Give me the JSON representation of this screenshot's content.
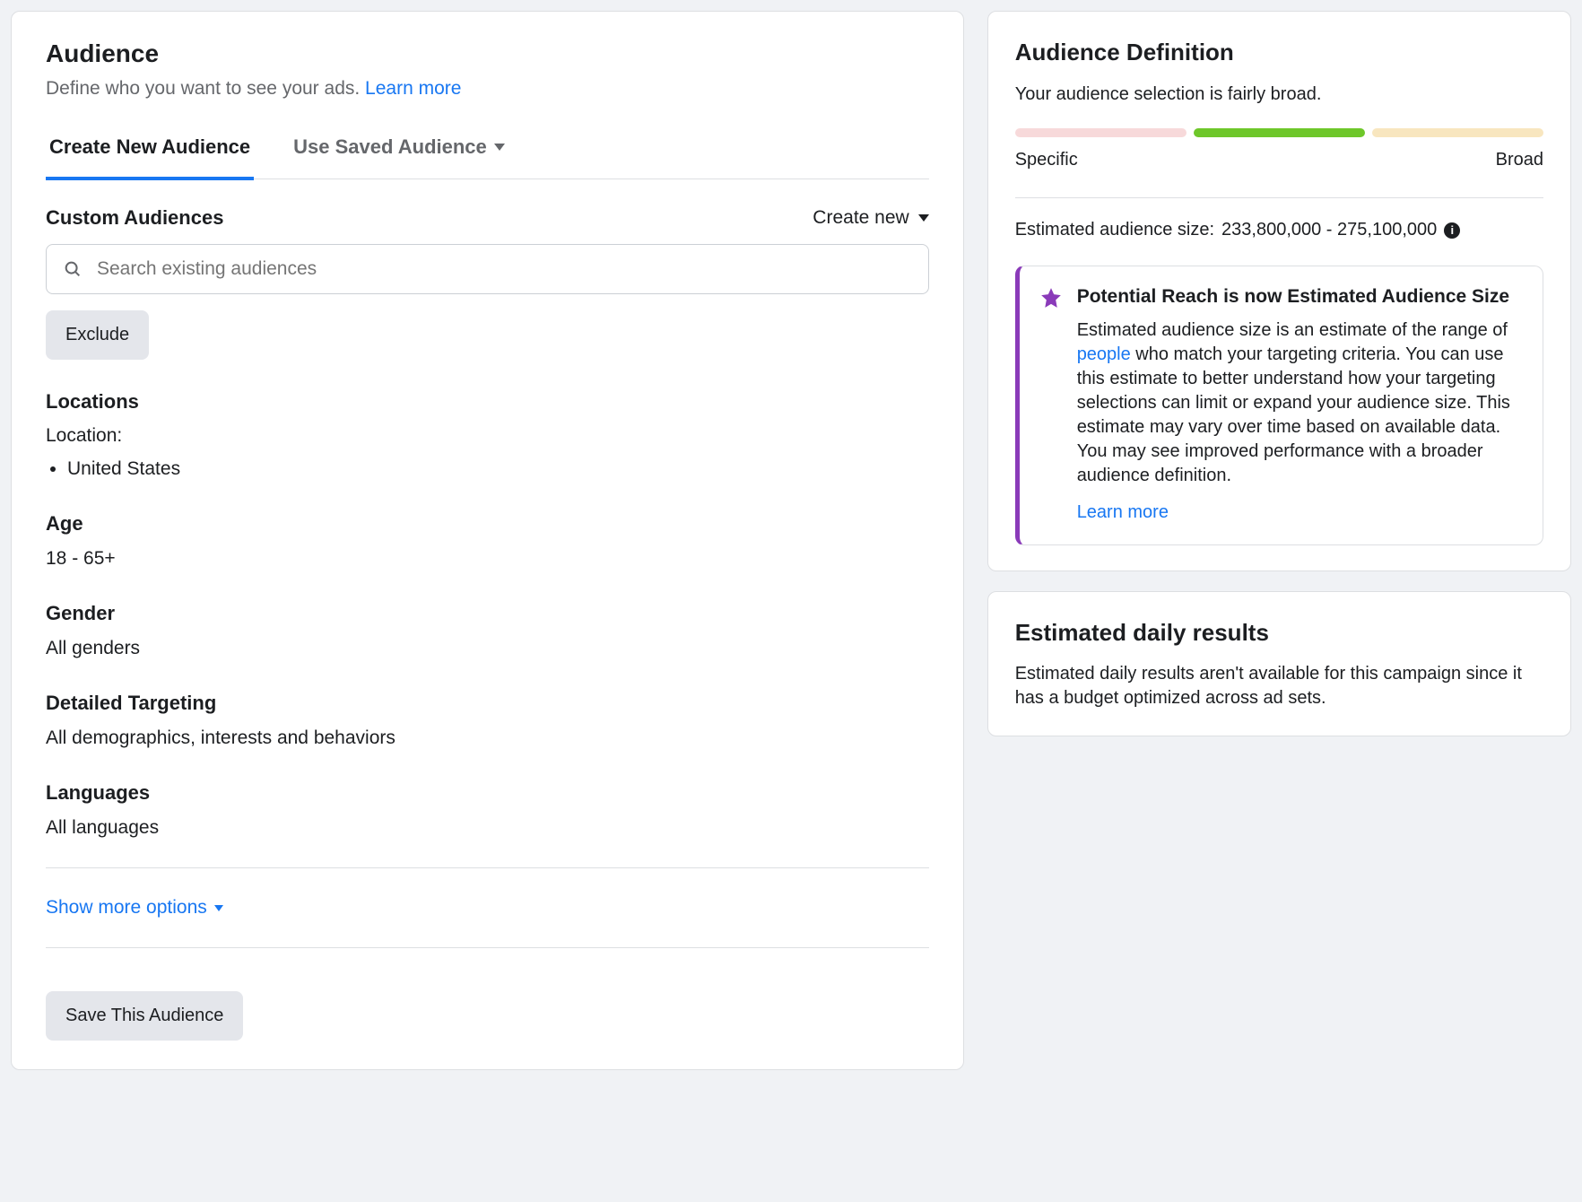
{
  "left": {
    "title": "Audience",
    "subtitle_pre": "Define who you want to see your ads. ",
    "learn_more": "Learn more",
    "tabs": {
      "create_new": "Create New Audience",
      "use_saved": "Use Saved Audience"
    },
    "custom_audiences": {
      "label": "Custom Audiences",
      "create_new": "Create new",
      "search_placeholder": "Search existing audiences",
      "exclude_btn": "Exclude"
    },
    "locations": {
      "label": "Locations",
      "sublabel": "Location:",
      "items": [
        "United States"
      ]
    },
    "age": {
      "label": "Age",
      "value": "18 - 65+"
    },
    "gender": {
      "label": "Gender",
      "value": "All genders"
    },
    "detailed_targeting": {
      "label": "Detailed Targeting",
      "value": "All demographics, interests and behaviors"
    },
    "languages": {
      "label": "Languages",
      "value": "All languages"
    },
    "show_more": "Show more options",
    "save_btn": "Save This Audience"
  },
  "definition": {
    "title": "Audience Definition",
    "subtitle": "Your audience selection is fairly broad.",
    "gauge": [
      "Specific",
      "Broad"
    ],
    "estimate_label": "Estimated audience size:",
    "estimate_value": "233,800,000 - 275,100,000",
    "notice": {
      "title": "Potential Reach is now Estimated Audience Size",
      "body_a": "Estimated audience size is an estimate of the range of ",
      "body_link": "people",
      "body_b": " who match your targeting criteria. You can use this estimate to better understand how your targeting selections can limit or expand your audience size. This estimate may vary over time based on available data. You may see improved performance with a broader audience definition.",
      "learn_more": "Learn more"
    }
  },
  "daily": {
    "title": "Estimated daily results",
    "body": "Estimated daily results aren't available for this campaign since it has a budget optimized across ad sets."
  }
}
